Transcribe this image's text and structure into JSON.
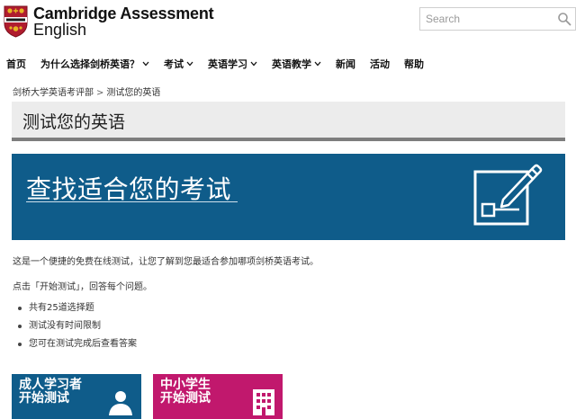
{
  "brand": {
    "line1": "Cambridge Assessment",
    "line2": "English"
  },
  "search": {
    "placeholder": "Search"
  },
  "nav": {
    "items": [
      {
        "label": "首页",
        "dropdown": false
      },
      {
        "label": "为什么选择剑桥英语？",
        "dropdown": true
      },
      {
        "label": "考试",
        "dropdown": true
      },
      {
        "label": "英语学习",
        "dropdown": true
      },
      {
        "label": "英语教学",
        "dropdown": true
      },
      {
        "label": "新闻",
        "dropdown": false
      },
      {
        "label": "活动",
        "dropdown": false
      },
      {
        "label": "帮助",
        "dropdown": false
      }
    ]
  },
  "breadcrumb": {
    "parent": "剑桥大学英语考评部",
    "separator": ">",
    "current": "测试您的英语"
  },
  "page": {
    "title": "测试您的英语"
  },
  "banner": {
    "title": "查找适合您的考试",
    "icon": "pencil-form-icon"
  },
  "content": {
    "intro": "这是一个便捷的免费在线测试，让您了解到您最适合参加哪项剑桥英语考试。",
    "instruction": "点击「开始测试」，回答每个问题。",
    "bullets": [
      "共有25道选择题",
      "测试没有时间限制",
      "您可在测试完成后查看答案"
    ]
  },
  "cta": {
    "adult": {
      "line1": "成人学习者",
      "line2": "开始测试",
      "icon": "person-icon",
      "color": "#0f5c8a"
    },
    "school": {
      "line1": "中小学生",
      "line2": "开始测试",
      "icon": "building-icon",
      "color": "#c1186d"
    }
  },
  "colors": {
    "banner": "#0f5c8a",
    "title_bar": "#ececec",
    "title_rule": "#7d7d7d",
    "shield_red": "#b01c2e",
    "shield_gold": "#e6b422"
  }
}
